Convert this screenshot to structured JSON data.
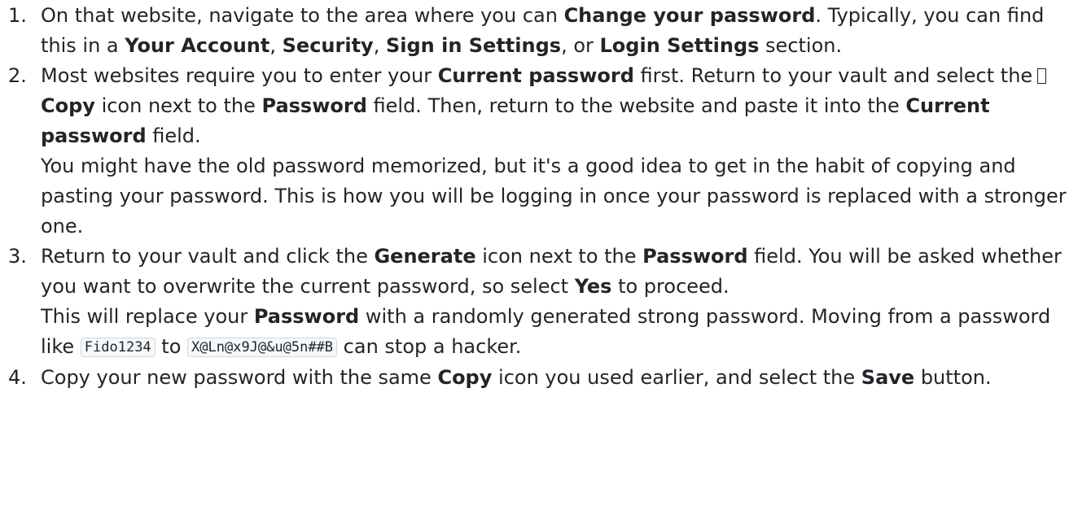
{
  "steps": [
    {
      "number": "1.",
      "p1": {
        "a": "On that website, navigate to the area where you can ",
        "b": "Change your password",
        "c": ". Typically, you can find this in a ",
        "d": "Your Account",
        "e": ", ",
        "f": "Security",
        "g": ", ",
        "h": "Sign in Settings",
        "i": ", or ",
        "j": "Login Settings",
        "k": " section."
      }
    },
    {
      "number": "2.",
      "p1": {
        "a": "Most websites require you to enter your ",
        "b": "Current password",
        "c": " first. Return to your vault and select the",
        "icon": "copy-icon",
        "d": "Copy",
        "e": " icon next to the ",
        "f": "Password",
        "g": " field. Then, return to the website and paste it into the ",
        "h": "Current password",
        "i": " field."
      },
      "p2": "You might have the old password memorized, but it's a good idea to get in the habit of copying and pasting your password. This is how you will be logging in once your password is replaced with a stronger one."
    },
    {
      "number": "3.",
      "p1": {
        "a": "Return to your vault and click the ",
        "b": "Generate",
        "c": " icon next to the ",
        "d": "Password",
        "e": " field. You will be asked whether you want to overwrite the current password, so select ",
        "f": "Yes",
        "g": " to proceed."
      },
      "p2": {
        "a": "This will replace your ",
        "b": "Password",
        "c": " with a randomly generated strong password. Moving from a password like ",
        "code1": "Fido1234",
        "d": " to ",
        "code2": "X@Ln@x9J@&u@5n##B",
        "e": " can stop a hacker."
      }
    },
    {
      "number": "4.",
      "p1": {
        "a": "Copy your new password with the same ",
        "b": "Copy",
        "c": " icon you used earlier, and select the ",
        "d": "Save",
        "e": " button."
      }
    }
  ]
}
